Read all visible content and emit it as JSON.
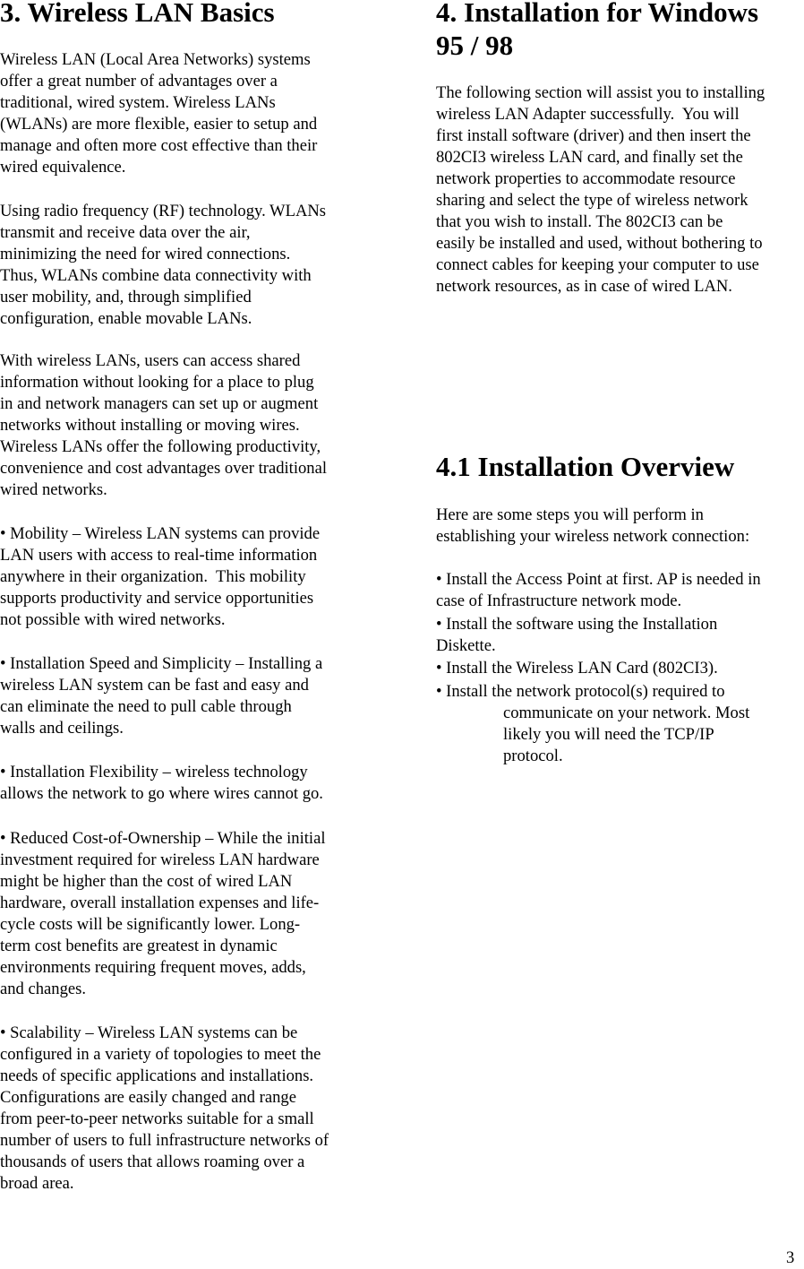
{
  "left_column": {
    "heading": "3. Wireless LAN Basics",
    "paragraphs": [
      {
        "lines": [
          "Wireless LAN (Local Area Networks) systems",
          "offer a great number of advantages over a",
          "traditional, wired system. Wireless LANs",
          "(WLANs) are more flexible, easier to setup and",
          "manage and often more cost effective than their",
          "wired equivalence."
        ]
      },
      {
        "lines": [
          "Using radio frequency (RF) technology. WLANs",
          "transmit and receive data over the air,",
          "minimizing the need for wired connections.",
          "Thus, WLANs combine data connectivity with",
          "user mobility, and, through simplified",
          "configuration, enable movable LANs."
        ]
      },
      {
        "lines": [
          "With wireless LANs, users can access shared",
          "information without looking for a place to plug",
          "in and network managers can set up or augment",
          "networks without installing or moving wires.",
          "Wireless LANs offer the following productivity,",
          "convenience and cost advantages over traditional",
          "wired networks."
        ]
      },
      {
        "lines": [
          "• Mobility – Wireless LAN systems can provide",
          "LAN users with access to real-time information",
          "anywhere in their organization.  This mobility",
          "supports productivity and service opportunities",
          "not possible with wired networks."
        ]
      },
      {
        "lines": [
          "• Installation Speed and Simplicity – Installing a",
          "wireless LAN system can be fast and easy and",
          "can eliminate the need to pull cable through",
          "walls and ceilings."
        ]
      },
      {
        "lines": [
          "• Installation Flexibility – wireless technology",
          "allows the network to go where wires cannot go."
        ]
      },
      {
        "lines": [
          "• Reduced Cost-of-Ownership – While the initial",
          "investment required for wireless LAN hardware",
          "might be higher than the cost of wired LAN",
          "hardware, overall installation expenses and life-",
          "cycle costs will be significantly lower. Long-",
          "term cost benefits are greatest in dynamic",
          "environments requiring frequent moves, adds,",
          "and changes."
        ]
      },
      {
        "lines": [
          "• Scalability – Wireless LAN systems can be",
          "configured in a variety of topologies to meet the",
          "needs of specific applications and installations.",
          "Configurations are easily changed and range",
          "from peer-to-peer networks suitable for a small",
          "number of users to full infrastructure networks of",
          "thousands of users that allows roaming over a",
          "broad area."
        ]
      }
    ]
  },
  "right_column": {
    "heading_lines": [
      "4. Installation for Windows",
      "95 / 98"
    ],
    "intro_lines": [
      "The following section will assist you to installing",
      "wireless LAN Adapter successfully.  You will",
      "first install software (driver) and then insert the",
      "802CI3 wireless LAN card, and finally set the",
      "network properties to accommodate resource",
      "sharing and select the type of wireless network",
      "that you wish to install. The 802CI3 can be",
      "easily be installed and used, without bothering to",
      "connect cables for keeping your computer to use",
      "network resources, as in case of wired LAN."
    ],
    "subheading": "4.1 Installation Overview",
    "overview_lines": [
      "Here are some steps you will perform in",
      "establishing your wireless network connection:"
    ],
    "steps": [
      [
        "• Install the Access Point at first. AP is needed in",
        "case of Infrastructure network mode."
      ],
      [
        "• Install the software using the Installation",
        "Diskette."
      ],
      [
        "• Install the Wireless LAN Card (802CI3)."
      ],
      [
        "• Install the network protocol(s) required to"
      ]
    ],
    "step4_continuation": [
      "communicate on your network. Most",
      "likely you will need the TCP/IP",
      "protocol."
    ]
  },
  "page_number": "3"
}
